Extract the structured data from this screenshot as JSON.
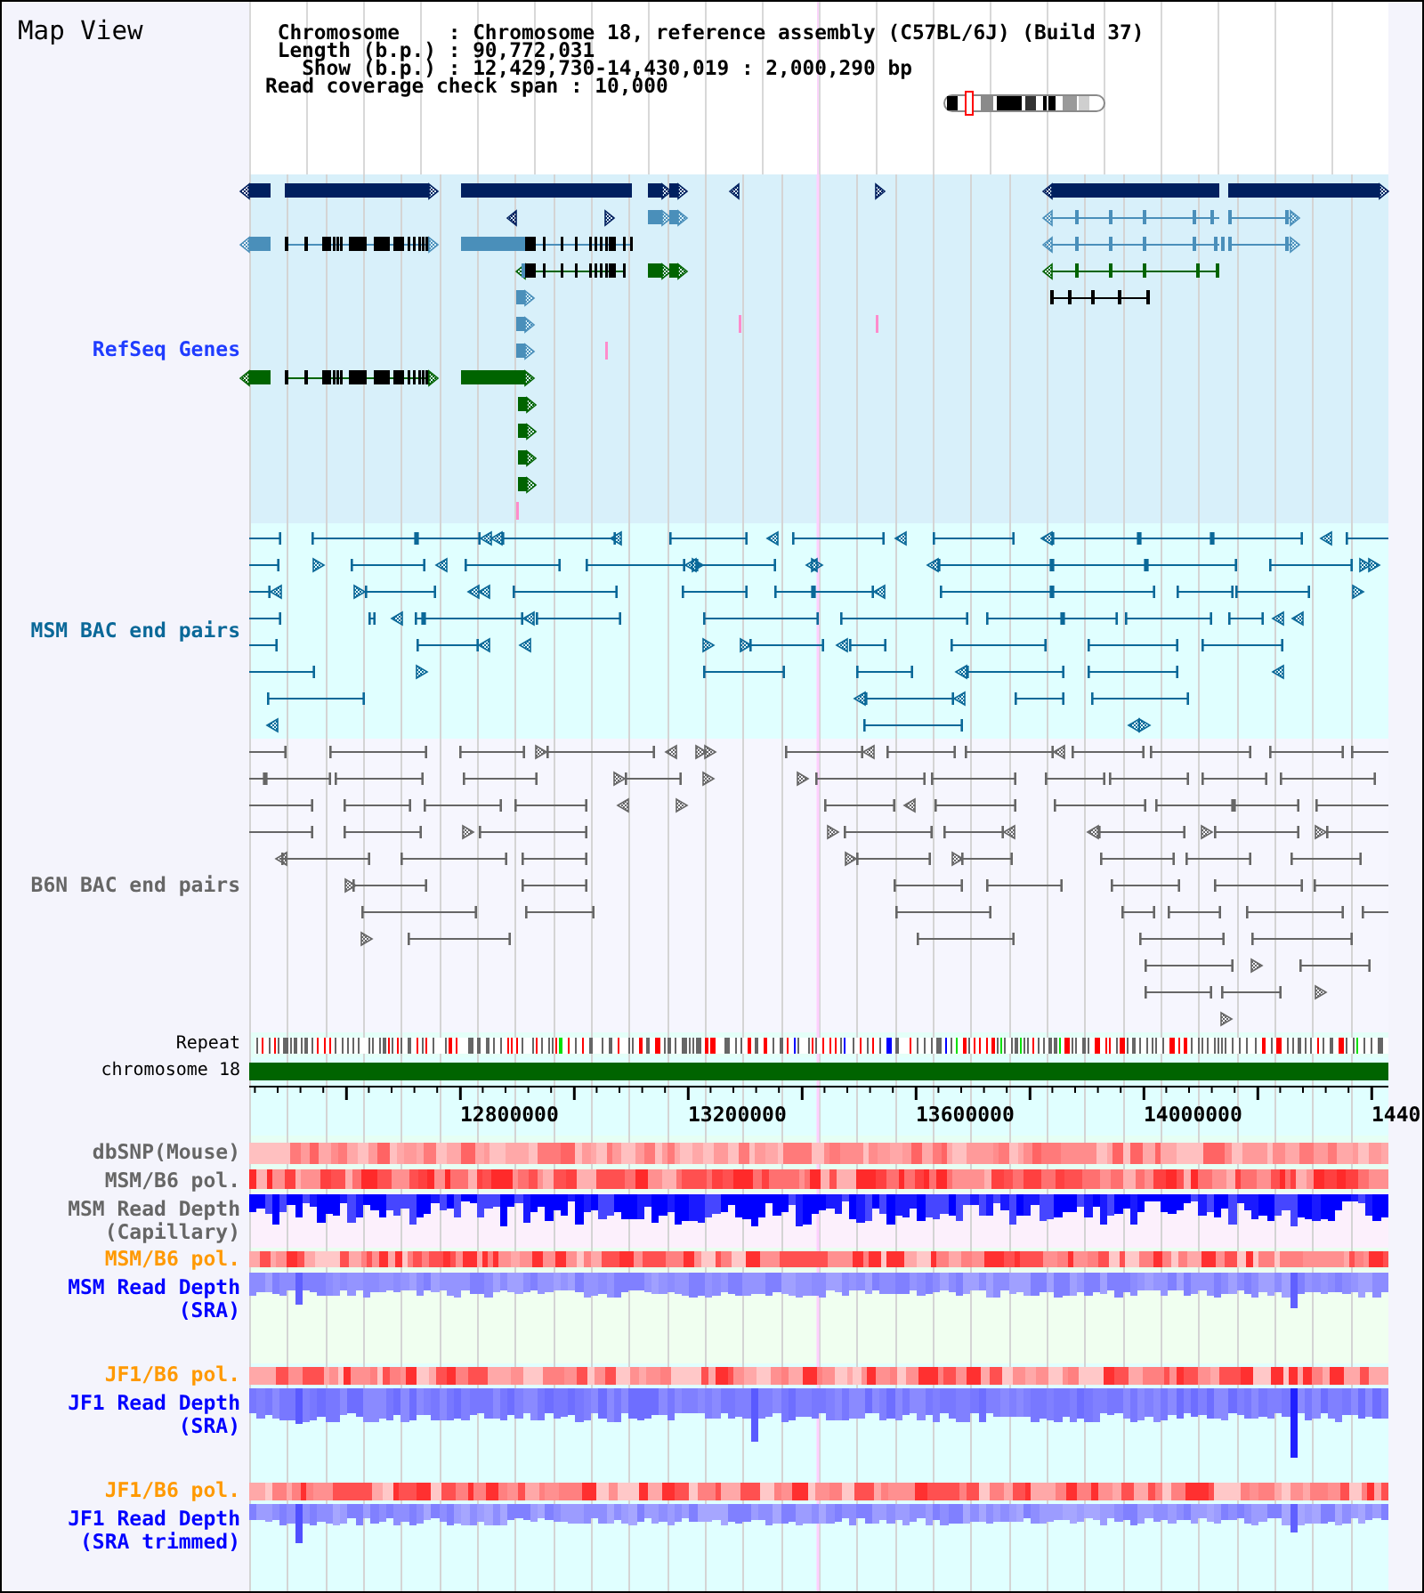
{
  "window": {
    "title": "Map View"
  },
  "header": {
    "lines": [
      "Chromosome    : Chromosome 18, reference assembly (C57BL/6J) (Build 37)",
      "Length (b.p.) : 90,772,031",
      "Show (b.p.) : 12,429,730-14,430,019 : 2,000,290 bp",
      "Read coverage check span : 10,000"
    ]
  },
  "tracks": [
    {
      "kind": "genes",
      "label": "RefSeq Genes",
      "color": "#1f3cff"
    },
    {
      "kind": "pairs",
      "label": "MSM BAC end pairs",
      "color": "#0a6898"
    },
    {
      "kind": "pairs",
      "label": "B6N BAC end pairs",
      "color": "#666666"
    },
    {
      "kind": "repeat",
      "label": "Repeat",
      "color": "#000000"
    },
    {
      "kind": "chromosome",
      "label": "chromosome 18",
      "color": "#000000"
    },
    {
      "kind": "axis",
      "ticks": [
        "12800000",
        "13200000",
        "13600000",
        "14000000",
        "1440"
      ]
    },
    {
      "kind": "heat",
      "label": "dbSNP(Mouse)",
      "color": "#666666"
    },
    {
      "kind": "heat",
      "label": "MSM/B6 pol.",
      "color": "#666666"
    },
    {
      "kind": "depth",
      "label": "MSM Read Depth (Capillary)",
      "color": "#666666"
    },
    {
      "kind": "heat",
      "label": "MSM/B6 pol.",
      "color": "#ff9900"
    },
    {
      "kind": "depth",
      "label": "MSM Read Depth (SRA)",
      "color": "#0000ff"
    },
    {
      "kind": "heat",
      "label": "JF1/B6 pol.",
      "color": "#ff9900"
    },
    {
      "kind": "depth",
      "label": "JF1 Read Depth (SRA)",
      "color": "#0000ff"
    },
    {
      "kind": "heat",
      "label": "JF1/B6 pol.",
      "color": "#ff9900"
    },
    {
      "kind": "depth",
      "label": "JF1 Read Depth (SRA trimmed)",
      "color": "#0000ff"
    }
  ]
}
